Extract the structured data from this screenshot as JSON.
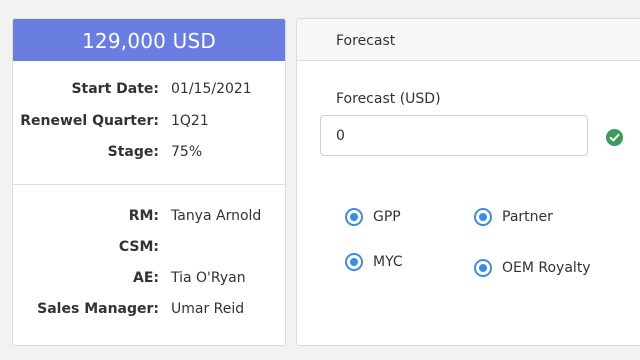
{
  "summary": {
    "amount": "129,000 USD",
    "deal_details": [
      {
        "label": "Start Date:",
        "value": "01/15/2021"
      },
      {
        "label": "Renewel Quarter:",
        "value": "1Q21"
      },
      {
        "label": "Stage:",
        "value": "75%"
      }
    ],
    "people": [
      {
        "label": "RM:",
        "value": "Tanya Arnold"
      },
      {
        "label": "CSM:",
        "value": ""
      },
      {
        "label": "AE:",
        "value": "Tia O'Ryan"
      },
      {
        "label": "Sales Manager:",
        "value": "Umar Reid"
      }
    ],
    "header_color": "#6a7de0"
  },
  "forecast": {
    "panel_title": "Forecast",
    "field_label": "Forecast (USD)",
    "field_value": "0",
    "valid_icon": "check-circle-icon",
    "options": [
      {
        "label": "GPP",
        "selected": true
      },
      {
        "label": "Partner",
        "selected": true
      },
      {
        "label": "MYC",
        "selected": true
      },
      {
        "label": "OEM Royalty",
        "selected": true
      }
    ],
    "accent_color": "#3b8de0",
    "valid_color": "#3c9a5a"
  }
}
